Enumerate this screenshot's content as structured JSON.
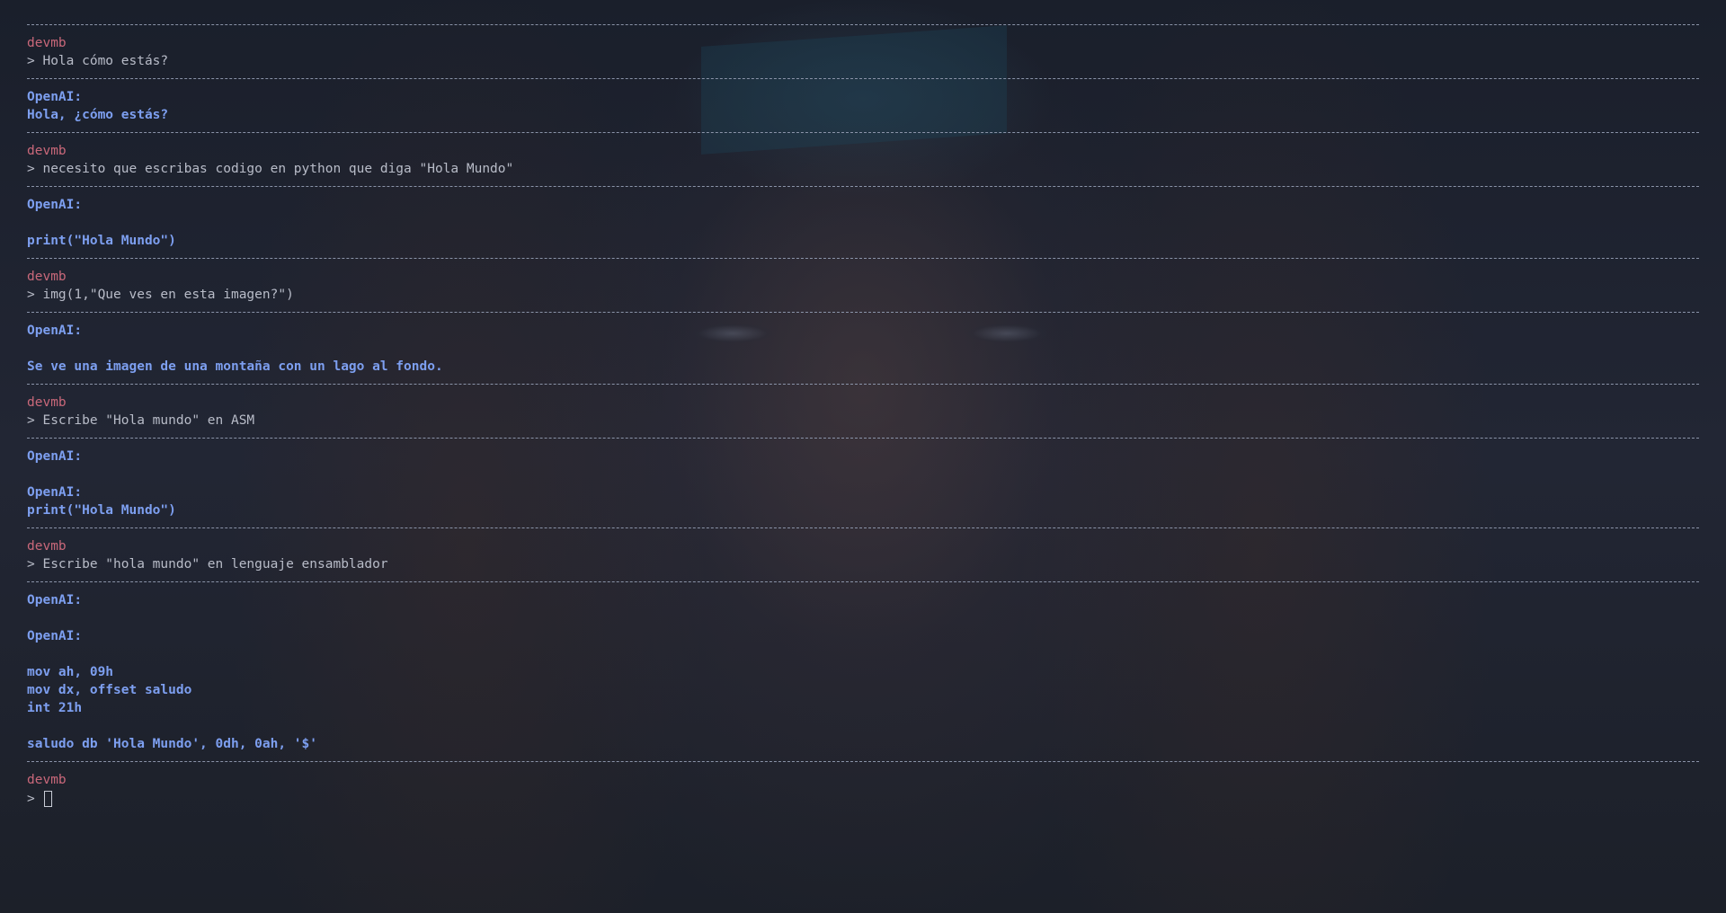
{
  "user": "devmb",
  "ai_name": "OpenAI:",
  "prompt_symbol": ">",
  "conversation": [
    {
      "user_msg": "> Hola cómo estás?",
      "ai_lines": [
        "Hola, ¿cómo estás?"
      ]
    },
    {
      "user_msg": "> necesito que escribas codigo en python que diga \"Hola Mundo\"",
      "ai_lines": [
        "",
        "print(\"Hola Mundo\")"
      ]
    },
    {
      "user_msg": "> img(1,\"Que ves en esta imagen?\")",
      "ai_lines": [
        "",
        "Se ve una imagen de una montaña con un lago al fondo."
      ]
    },
    {
      "user_msg": "> Escribe \"Hola mundo\" en ASM",
      "ai_lines": [
        "",
        "OpenAI:",
        "print(\"Hola Mundo\")"
      ]
    },
    {
      "user_msg": "> Escribe \"hola mundo\" en lenguaje ensamblador",
      "ai_lines": [
        "",
        "OpenAI:",
        "",
        "mov ah, 09h",
        "mov dx, offset saludo",
        "int 21h",
        "",
        "saludo db 'Hola Mundo', 0dh, 0ah, '$'"
      ]
    }
  ]
}
